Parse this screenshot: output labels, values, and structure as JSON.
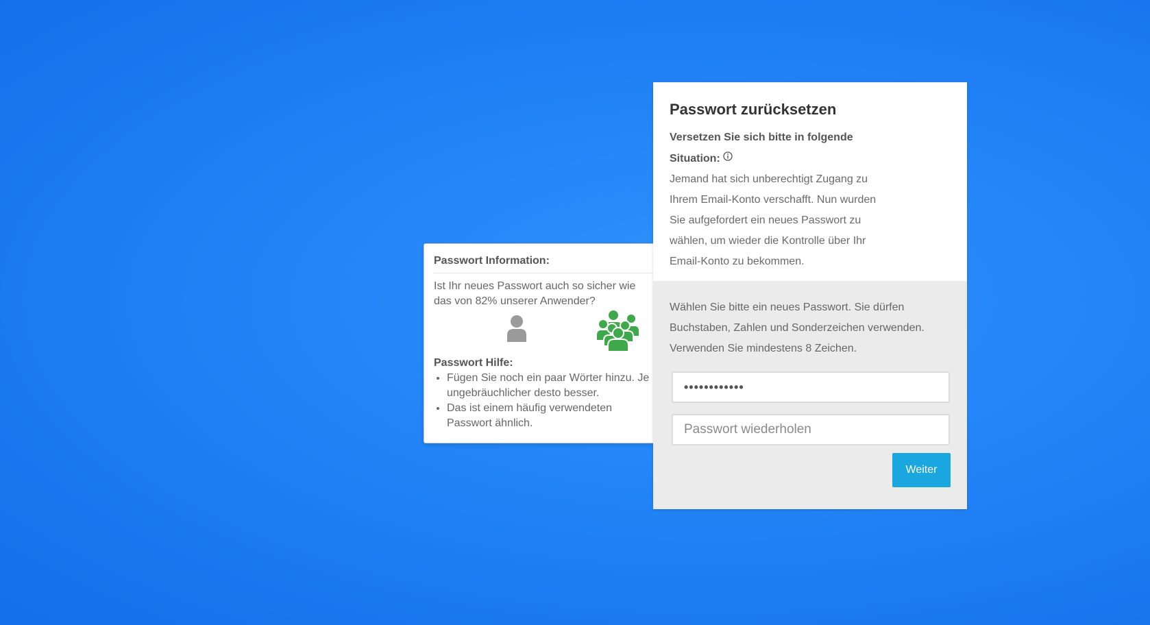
{
  "reset_card": {
    "title": "Passwort zurücksetzen",
    "situation_heading": "Versetzen Sie sich bitte in folgende Situation:",
    "situation_text": "Jemand hat sich unberechtigt Zugang zu Ihrem Email-Konto verschafft. Nun wurden Sie aufgefordert ein neues Passwort zu wählen, um wieder die Kontrolle über Ihr Email-Konto zu bekommen.",
    "instruction": "Wählen Sie bitte ein neues Passwort. Sie dürfen Buchstaben, Zahlen und Sonderzeichen verwenden. Verwenden Sie mindestens 8 Zeichen.",
    "password_field": {
      "value": "••••••••••••",
      "type": "password"
    },
    "repeat_field": {
      "value": "",
      "placeholder": "Passwort wiederholen"
    },
    "submit_label": "Weiter"
  },
  "popover": {
    "title": "Passwort Information:",
    "question": "Ist Ihr neues Passwort auch so sicher wie das von 82% unserer Anwender?",
    "icons": {
      "you": "single-user-icon",
      "others": "user-group-icon"
    },
    "help_title": "Passwort Hilfe:",
    "help_items": [
      "Fügen Sie noch ein paar Wörter hinzu. Je ungebräuchlicher desto besser.",
      "Das ist einem häufig verwendeten Passwort ähnlich."
    ]
  },
  "colors": {
    "background": "#2486f8",
    "button": "#1aa6df",
    "group_icon": "#3fa84a",
    "user_icon": "#9a9a9a",
    "bottom_panel": "#ebebeb"
  }
}
